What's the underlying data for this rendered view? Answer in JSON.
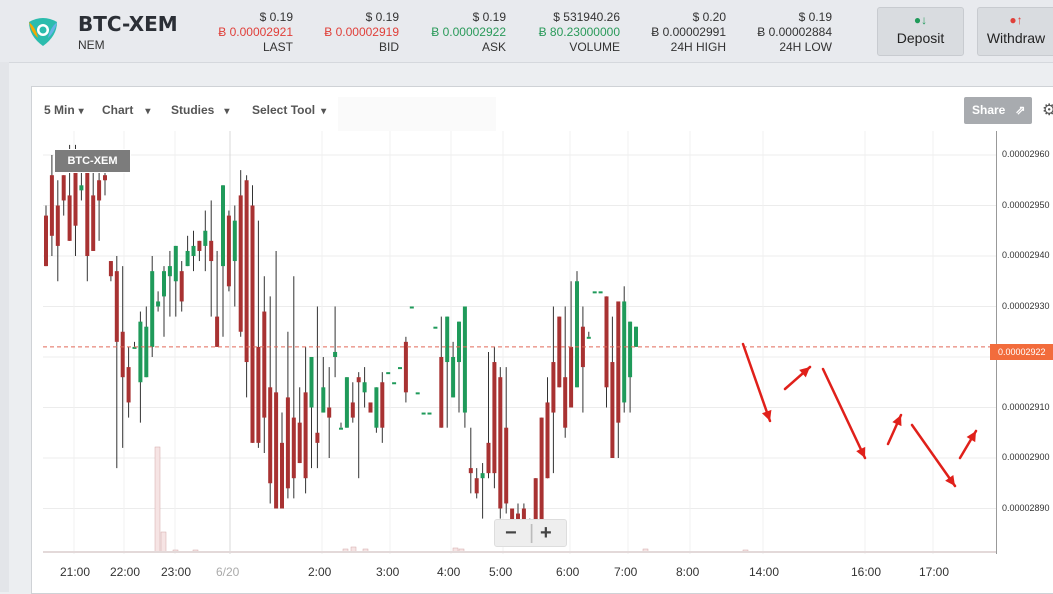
{
  "header": {
    "pair": "BTC-XEM",
    "coin_name": "NEM",
    "stats": [
      {
        "usd": "$ 0.19",
        "btc": "Ƀ 0.00002921",
        "color": "red",
        "label": "LAST"
      },
      {
        "usd": "$ 0.19",
        "btc": "Ƀ 0.00002919",
        "color": "red",
        "label": "BID"
      },
      {
        "usd": "$ 0.19",
        "btc": "Ƀ 0.00002922",
        "color": "green",
        "label": "ASK"
      },
      {
        "usd": "$ 531940.26",
        "btc": "Ƀ 80.23000000",
        "color": "green",
        "label": "VOLUME"
      },
      {
        "usd": "$ 0.20",
        "btc": "Ƀ 0.00002991",
        "color": "dark",
        "label": "24H HIGH"
      },
      {
        "usd": "$ 0.19",
        "btc": "Ƀ 0.00002884",
        "color": "dark",
        "label": "24H LOW"
      }
    ],
    "deposit_label": "Deposit",
    "withdraw_label": "Withdraw"
  },
  "toolbar": {
    "interval": "5 Min",
    "chart": "Chart",
    "studies": "Studies",
    "select_tool": "Select Tool",
    "share": "Share"
  },
  "chart_tag": "BTC-XEM",
  "current_price_tag": "0.00002922",
  "chart_data": {
    "type": "candlestick",
    "y_ticks": [
      "0.00002960",
      "0.00002950",
      "0.00002940",
      "0.00002930",
      "0.00002920",
      "0.00002910",
      "0.00002900",
      "0.00002890"
    ],
    "x_ticks": [
      "21:00",
      "22:00",
      "23:00",
      "6/20",
      "2:00",
      "3:00",
      "4:00",
      "5:00",
      "6:00",
      "7:00",
      "8:00",
      "14:00",
      "16:00",
      "17:00"
    ],
    "current_price": 2.922e-05,
    "colors": {
      "up": "#1f9a5a",
      "down": "#a83232",
      "annotation": "#e0201a",
      "price_line": "#e26a5a"
    }
  }
}
